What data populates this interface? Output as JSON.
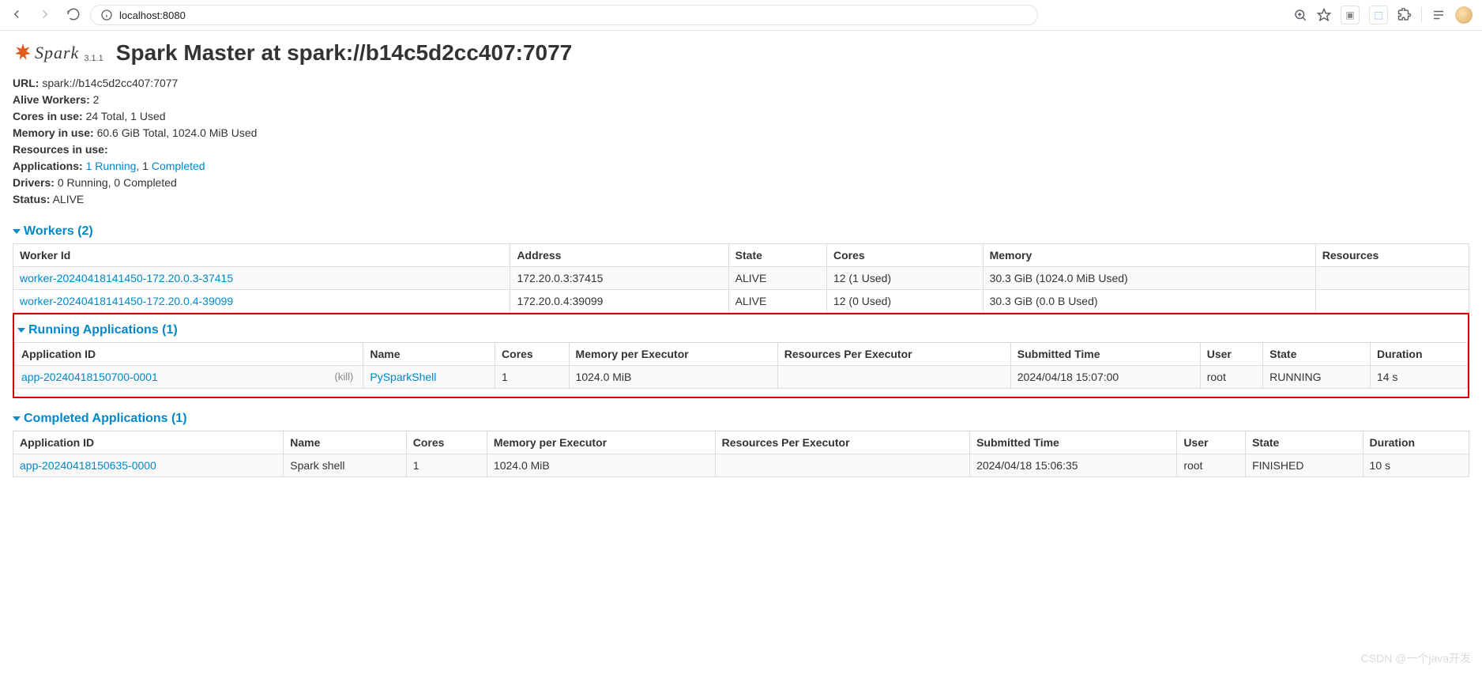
{
  "browser": {
    "url": "localhost:8080"
  },
  "header": {
    "logo_text": "Spark",
    "version": "3.1.1",
    "title": "Spark Master at spark://b14c5d2cc407:7077"
  },
  "summary": {
    "url_label": "URL:",
    "url_value": "spark://b14c5d2cc407:7077",
    "alive_workers_label": "Alive Workers:",
    "alive_workers_value": "2",
    "cores_label": "Cores in use:",
    "cores_value": "24 Total, 1 Used",
    "memory_label": "Memory in use:",
    "memory_value": "60.6 GiB Total, 1024.0 MiB Used",
    "resources_label": "Resources in use:",
    "resources_value": "",
    "apps_label": "Applications:",
    "apps_running_link": "1 Running",
    "apps_sep": ", 1 ",
    "apps_completed_link": "Completed",
    "drivers_label": "Drivers:",
    "drivers_value": "0 Running, 0 Completed",
    "status_label": "Status:",
    "status_value": "ALIVE"
  },
  "workers_section": {
    "title": "Workers (2)",
    "cols": [
      "Worker Id",
      "Address",
      "State",
      "Cores",
      "Memory",
      "Resources"
    ],
    "rows": [
      {
        "id": "worker-20240418141450-172.20.0.3-37415",
        "address": "172.20.0.3:37415",
        "state": "ALIVE",
        "cores": "12 (1 Used)",
        "memory": "30.3 GiB (1024.0 MiB Used)",
        "resources": ""
      },
      {
        "id": "worker-20240418141450-172.20.0.4-39099",
        "address": "172.20.0.4:39099",
        "state": "ALIVE",
        "cores": "12 (0 Used)",
        "memory": "30.3 GiB (0.0 B Used)",
        "resources": ""
      }
    ]
  },
  "running_section": {
    "title": "Running Applications (1)",
    "cols": [
      "Application ID",
      "Name",
      "Cores",
      "Memory per Executor",
      "Resources Per Executor",
      "Submitted Time",
      "User",
      "State",
      "Duration"
    ],
    "rows": [
      {
        "id": "app-20240418150700-0001",
        "kill": "(kill)",
        "name": "PySparkShell",
        "cores": "1",
        "mem": "1024.0 MiB",
        "res": "",
        "time": "2024/04/18 15:07:00",
        "user": "root",
        "state": "RUNNING",
        "dur": "14 s"
      }
    ]
  },
  "completed_section": {
    "title": "Completed Applications (1)",
    "cols": [
      "Application ID",
      "Name",
      "Cores",
      "Memory per Executor",
      "Resources Per Executor",
      "Submitted Time",
      "User",
      "State",
      "Duration"
    ],
    "rows": [
      {
        "id": "app-20240418150635-0000",
        "name": "Spark shell",
        "cores": "1",
        "mem": "1024.0 MiB",
        "res": "",
        "time": "2024/04/18 15:06:35",
        "user": "root",
        "state": "FINISHED",
        "dur": "10 s"
      }
    ]
  },
  "watermark": "CSDN @一个java开发"
}
